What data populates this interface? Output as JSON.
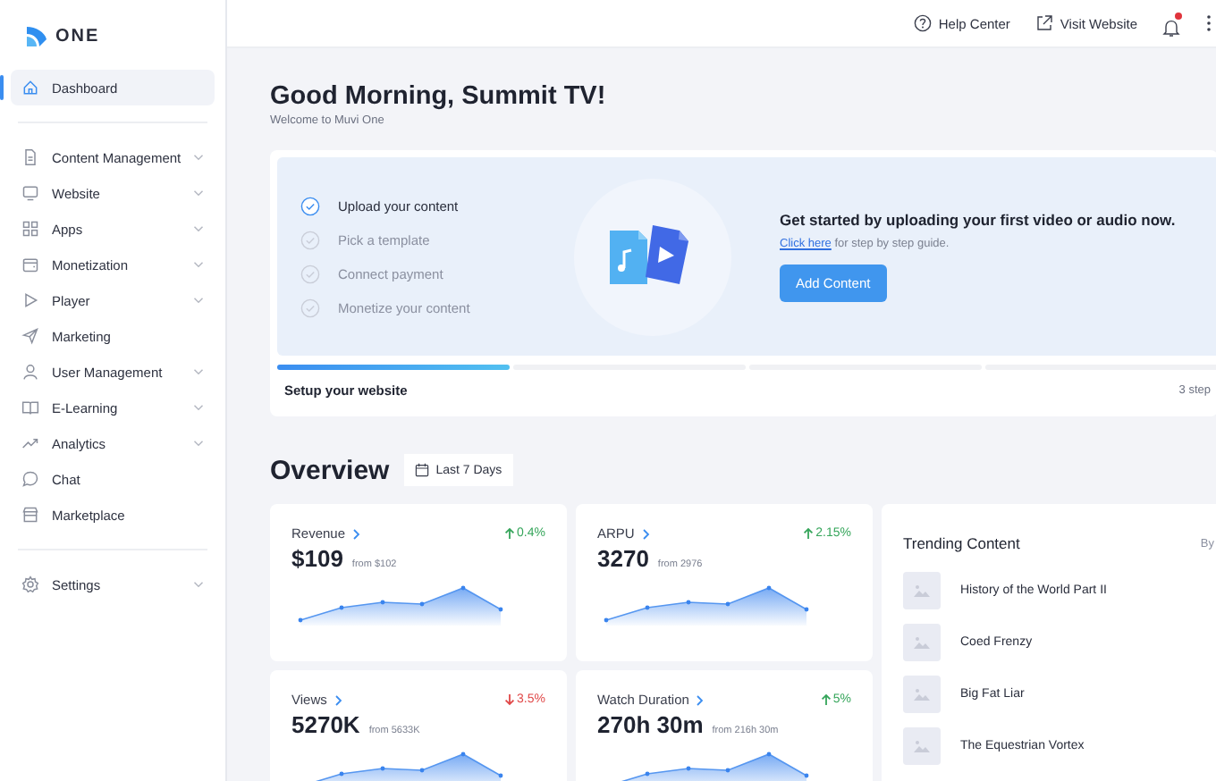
{
  "brand": {
    "name": "ONE"
  },
  "sidebar": {
    "items": [
      {
        "label": "Dashboard",
        "selected": true,
        "has_submenu": false
      },
      {
        "label": "Content Management",
        "selected": false,
        "has_submenu": true
      },
      {
        "label": "Website",
        "selected": false,
        "has_submenu": true
      },
      {
        "label": "Apps",
        "selected": false,
        "has_submenu": true
      },
      {
        "label": "Monetization",
        "selected": false,
        "has_submenu": true
      },
      {
        "label": "Player",
        "selected": false,
        "has_submenu": true
      },
      {
        "label": "Marketing",
        "selected": false,
        "has_submenu": false
      },
      {
        "label": "User Management",
        "selected": false,
        "has_submenu": true
      },
      {
        "label": "E-Learning",
        "selected": false,
        "has_submenu": true
      },
      {
        "label": "Analytics",
        "selected": false,
        "has_submenu": true
      },
      {
        "label": "Chat",
        "selected": false,
        "has_submenu": false
      },
      {
        "label": "Marketplace",
        "selected": false,
        "has_submenu": false
      },
      {
        "label": "Settings",
        "selected": false,
        "has_submenu": true
      }
    ]
  },
  "topbar": {
    "help": "Help Center",
    "visit": "Visit Website",
    "has_notification": true
  },
  "greeting": {
    "title": "Good Morning, Summit TV!",
    "subtitle": "Welcome to Muvi One"
  },
  "setup": {
    "steps": [
      {
        "label": "Upload your content",
        "done": true
      },
      {
        "label": "Pick a template",
        "done": false
      },
      {
        "label": "Connect payment",
        "done": false
      },
      {
        "label": "Monetize your content",
        "done": false
      }
    ],
    "headline": "Get started by uploading your first video or audio now.",
    "link": "Click here",
    "link_rest": " for step by step guide.",
    "button": "Add Content",
    "footer": "Setup your website",
    "count": "3 step"
  },
  "overview": {
    "title": "Overview",
    "range": "Last 7 Days"
  },
  "stats": [
    {
      "label": "Revenue",
      "value": "$109",
      "from": "from $102",
      "change": "0.4%",
      "kind": "up"
    },
    {
      "label": "ARPU",
      "value": "3270",
      "from": "from 2976",
      "change": "2.15%",
      "kind": "up"
    },
    {
      "label": "Views",
      "value": "5270K",
      "from": "from 5633K",
      "change": "3.5%",
      "kind": "down"
    },
    {
      "label": "Watch Duration",
      "value": "270h 30m",
      "from": "from 216h 30m",
      "change": "5%",
      "kind": "up"
    }
  ],
  "trending": {
    "title": "Trending Content",
    "by": "By",
    "items": [
      "History of the World Part II",
      "Coed Frenzy",
      "Big Fat Liar",
      "The Equestrian Vortex"
    ]
  }
}
